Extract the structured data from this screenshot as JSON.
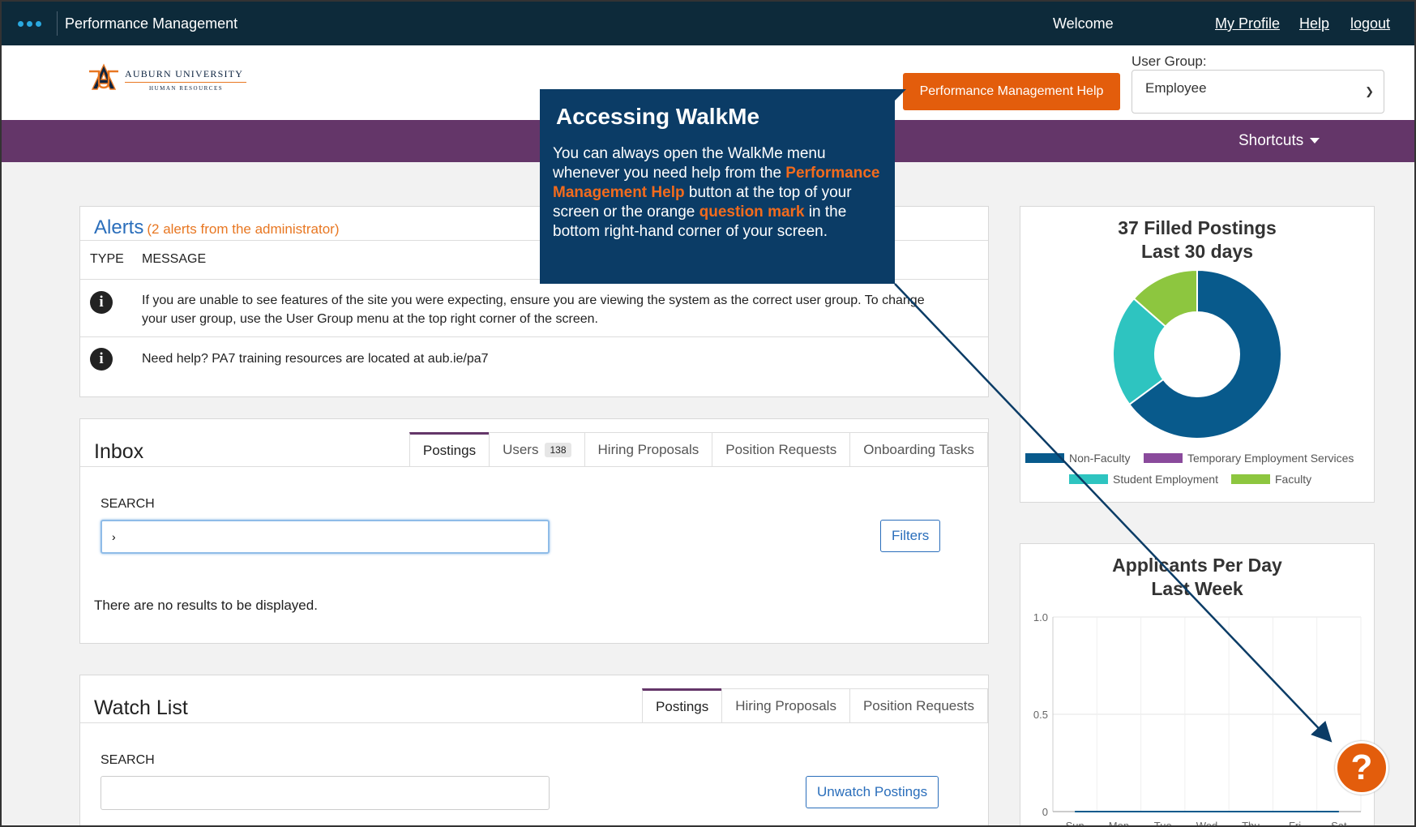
{
  "topbar": {
    "app_title": "Performance Management",
    "welcome": "Welcome",
    "links": [
      "My Profile",
      "Help",
      "logout"
    ]
  },
  "header": {
    "logo_title": "AUBURN UNIVERSITY",
    "logo_sub": "HUMAN RESOURCES",
    "help_button": "Performance Management Help",
    "user_group_label": "User Group:",
    "user_group_value": "Employee"
  },
  "nav": {
    "shortcuts": "Shortcuts"
  },
  "tooltip": {
    "title": "Accessing WalkMe",
    "body_1": "You can always open the WalkMe menu whenever you need help from the",
    "highlight_1": "Performance Management Help",
    "body_2": "button at the top of your screen or the orange",
    "highlight_2": "question mark",
    "body_3": "in the bottom right-hand corner of your screen."
  },
  "alerts": {
    "title": "Alerts",
    "subtitle": "(2 alerts from the administrator)",
    "col_type": "TYPE",
    "col_message": "MESSAGE",
    "items": [
      {
        "message": "If you are unable to see features of the site you were expecting, ensure you are viewing the system as the correct user group. To change your user group, use the User Group menu at the top right corner of the screen."
      },
      {
        "message": "Need help? PA7 training resources are located at aub.ie/pa7"
      }
    ]
  },
  "inbox": {
    "title": "Inbox",
    "tabs": [
      {
        "label": "Postings",
        "active": true
      },
      {
        "label": "Users",
        "count": "138"
      },
      {
        "label": "Hiring Proposals"
      },
      {
        "label": "Position Requests"
      },
      {
        "label": "Onboarding Tasks"
      }
    ],
    "search_label": "SEARCH",
    "search_value": "›",
    "filters_button": "Filters",
    "empty_message": "There are no results to be displayed."
  },
  "watch_list": {
    "title": "Watch List",
    "tabs": [
      {
        "label": "Postings",
        "active": true
      },
      {
        "label": "Hiring Proposals"
      },
      {
        "label": "Position Requests"
      }
    ],
    "search_label": "SEARCH",
    "unwatch_button": "Unwatch Postings"
  },
  "colors": {
    "topbar": "#0d2a3a",
    "purple": "#643669",
    "orange": "#e35d0c",
    "link_blue": "#2a6ebb",
    "tooltip_bg": "#0b3c66"
  },
  "chart_data": [
    {
      "type": "pie",
      "title": "37 Filled Postings",
      "subtitle": "Last 30 days",
      "categories": [
        "Non-Faculty",
        "Temporary Employment Services",
        "Student Employment",
        "Faculty"
      ],
      "values": [
        24,
        0,
        8,
        5
      ],
      "colors": [
        "#085a8c",
        "#8a4a9c",
        "#2ec4c0",
        "#8dc63f"
      ],
      "legend_position": "bottom"
    },
    {
      "type": "line",
      "title": "Applicants Per Day",
      "subtitle": "Last Week",
      "categories": [
        "Sun",
        "Mon",
        "Tue",
        "Wed",
        "Thu",
        "Fri",
        "Sat"
      ],
      "values": [
        0,
        0,
        0,
        0,
        0,
        0,
        0
      ],
      "ylim": [
        0,
        1.0
      ],
      "yticks": [
        "1.0",
        "0.5",
        "0"
      ],
      "grid": true
    }
  ]
}
